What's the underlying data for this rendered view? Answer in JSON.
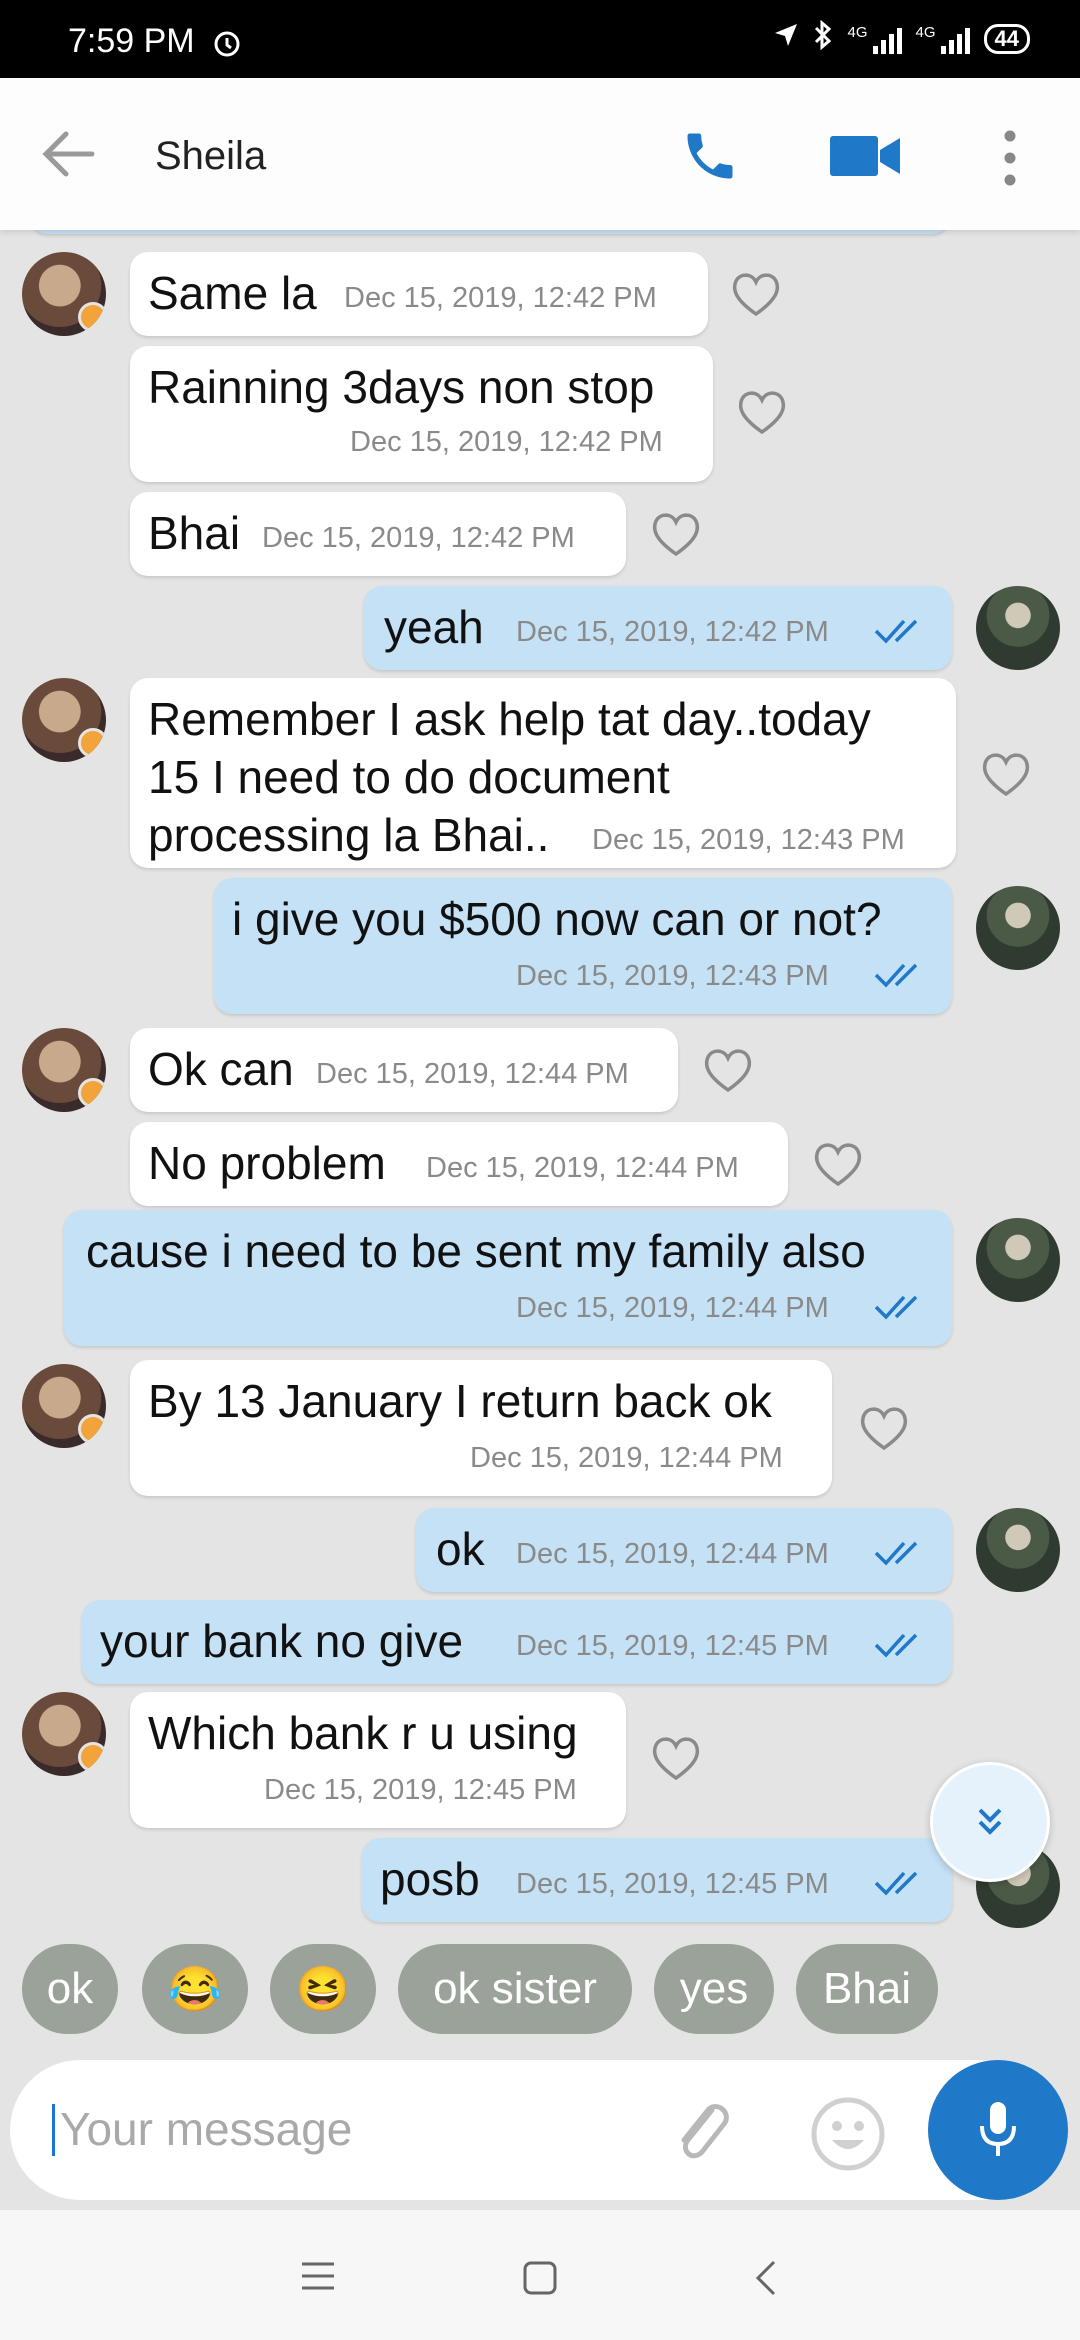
{
  "status_bar": {
    "time": "7:59 PM",
    "network_label_1": "4G",
    "network_label_2": "4G",
    "battery": "44"
  },
  "header": {
    "contact_name": "Sheila"
  },
  "messages": [
    {
      "dir": "in",
      "text": "Same la",
      "timestamp": "Dec 15, 2019, 12:42 PM"
    },
    {
      "dir": "in",
      "text": "Rainning 3days non stop",
      "timestamp": "Dec 15, 2019, 12:42 PM"
    },
    {
      "dir": "in",
      "text": "Bhai",
      "timestamp": "Dec 15, 2019, 12:42 PM"
    },
    {
      "dir": "out",
      "text": "yeah",
      "timestamp": "Dec 15, 2019, 12:42 PM"
    },
    {
      "dir": "in",
      "lines": [
        "Remember I ask help tat day..today",
        "15 I need to do document",
        "processing la Bhai.."
      ],
      "timestamp": "Dec 15, 2019, 12:43 PM"
    },
    {
      "dir": "out",
      "text": "i give you $500 now can or not?",
      "timestamp": "Dec 15, 2019, 12:43 PM"
    },
    {
      "dir": "in",
      "text": "Ok can",
      "timestamp": "Dec 15, 2019, 12:44 PM"
    },
    {
      "dir": "in",
      "text": "No problem",
      "timestamp": "Dec 15, 2019, 12:44 PM"
    },
    {
      "dir": "out",
      "text": "cause i need to be sent my family also",
      "timestamp": "Dec 15, 2019, 12:44 PM"
    },
    {
      "dir": "in",
      "text": "By 13 January I return back ok",
      "timestamp": "Dec 15, 2019, 12:44 PM"
    },
    {
      "dir": "out",
      "text": "ok",
      "timestamp": "Dec 15, 2019, 12:44 PM"
    },
    {
      "dir": "out",
      "text": "your bank no give",
      "timestamp": "Dec 15, 2019, 12:45 PM"
    },
    {
      "dir": "in",
      "text": "Which bank r u using",
      "timestamp": "Dec 15, 2019, 12:45 PM"
    },
    {
      "dir": "out",
      "text": "posb",
      "timestamp": "Dec 15, 2019, 12:45 PM"
    }
  ],
  "quick_replies": [
    {
      "type": "text",
      "label": "ok"
    },
    {
      "type": "emoji",
      "label": "😂"
    },
    {
      "type": "emoji",
      "label": "😆"
    },
    {
      "type": "text",
      "label": "ok sister"
    },
    {
      "type": "text",
      "label": "yes"
    },
    {
      "type": "text",
      "label": "Bhai"
    }
  ],
  "composer": {
    "placeholder": "Your message"
  },
  "colors": {
    "incoming_bubble": "#ffffff",
    "outgoing_bubble": "#c5e1f6",
    "accent": "#1f78c8",
    "chat_background": "#e4e4e4",
    "chip": "#9aa29a"
  }
}
